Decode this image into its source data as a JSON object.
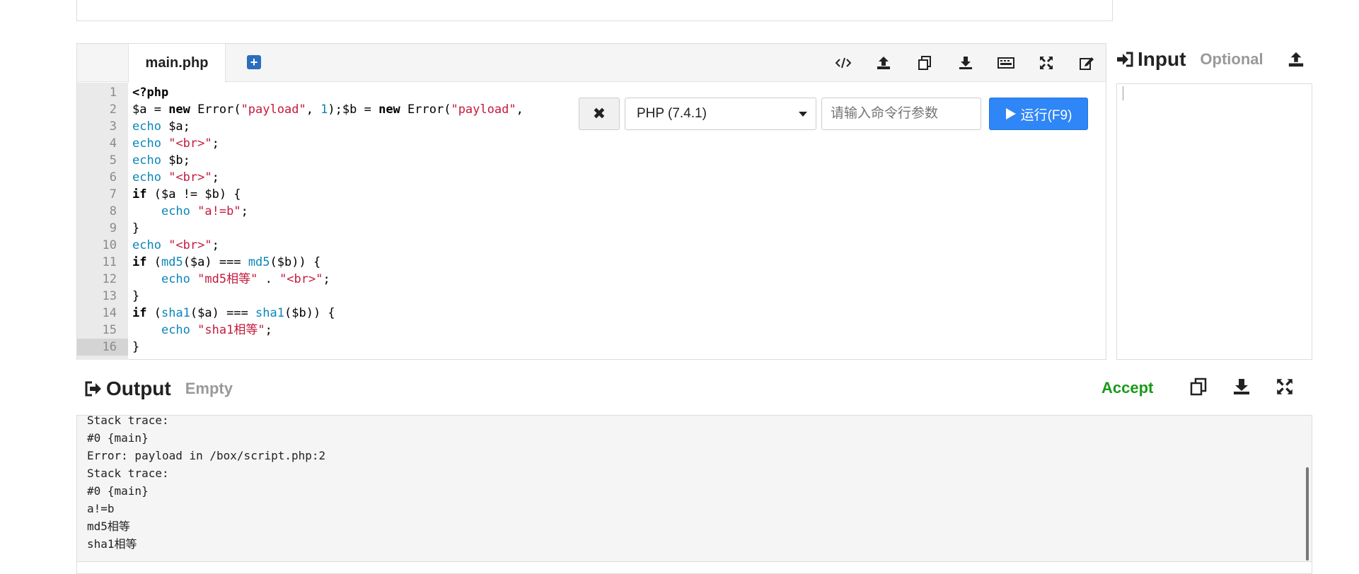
{
  "editor": {
    "tab_label": "main.php",
    "lines": [
      {
        "n": "1",
        "parts": [
          [
            "kw",
            "<?php"
          ]
        ]
      },
      {
        "n": "2",
        "parts": [
          [
            "",
            "$a = "
          ],
          [
            "kw",
            "new"
          ],
          [
            "",
            " Error("
          ],
          [
            "str",
            "\"payload\""
          ],
          [
            "",
            ", "
          ],
          [
            "num",
            "1"
          ],
          [
            "",
            ");$b = "
          ],
          [
            "kw",
            "new"
          ],
          [
            "",
            " Error("
          ],
          [
            "str",
            "\"payload\""
          ],
          [
            "",
            ","
          ]
        ]
      },
      {
        "n": "3",
        "parts": [
          [
            "fn",
            "echo"
          ],
          [
            "",
            " $a;"
          ]
        ]
      },
      {
        "n": "4",
        "parts": [
          [
            "fn",
            "echo"
          ],
          [
            "",
            " "
          ],
          [
            "str",
            "\"<br>\""
          ],
          [
            "",
            ";"
          ]
        ]
      },
      {
        "n": "5",
        "parts": [
          [
            "fn",
            "echo"
          ],
          [
            "",
            " $b;"
          ]
        ]
      },
      {
        "n": "6",
        "parts": [
          [
            "fn",
            "echo"
          ],
          [
            "",
            " "
          ],
          [
            "str",
            "\"<br>\""
          ],
          [
            "",
            ";"
          ]
        ]
      },
      {
        "n": "7",
        "parts": [
          [
            "kw",
            "if"
          ],
          [
            "",
            " ($a != $b) {"
          ]
        ]
      },
      {
        "n": "8",
        "parts": [
          [
            "",
            "    "
          ],
          [
            "fn",
            "echo"
          ],
          [
            "",
            " "
          ],
          [
            "str",
            "\"a!=b\""
          ],
          [
            "",
            ";"
          ]
        ]
      },
      {
        "n": "9",
        "parts": [
          [
            "",
            "}"
          ]
        ]
      },
      {
        "n": "10",
        "parts": [
          [
            "fn",
            "echo"
          ],
          [
            "",
            " "
          ],
          [
            "str",
            "\"<br>\""
          ],
          [
            "",
            ";"
          ]
        ]
      },
      {
        "n": "11",
        "parts": [
          [
            "kw",
            "if"
          ],
          [
            "",
            " ("
          ],
          [
            "fn",
            "md5"
          ],
          [
            "",
            "($a) === "
          ],
          [
            "fn",
            "md5"
          ],
          [
            "",
            "($b)) {"
          ]
        ]
      },
      {
        "n": "12",
        "parts": [
          [
            "",
            "    "
          ],
          [
            "fn",
            "echo"
          ],
          [
            "",
            " "
          ],
          [
            "str",
            "\"md5相等\""
          ],
          [
            "",
            " . "
          ],
          [
            "str",
            "\"<br>\""
          ],
          [
            "",
            ";"
          ]
        ]
      },
      {
        "n": "13",
        "parts": [
          [
            "",
            "}"
          ]
        ]
      },
      {
        "n": "14",
        "parts": [
          [
            "kw",
            "if"
          ],
          [
            "",
            " ("
          ],
          [
            "fn",
            "sha1"
          ],
          [
            "",
            "($a) === "
          ],
          [
            "fn",
            "sha1"
          ],
          [
            "",
            "($b)) {"
          ]
        ]
      },
      {
        "n": "15",
        "parts": [
          [
            "",
            "    "
          ],
          [
            "fn",
            "echo"
          ],
          [
            "",
            " "
          ],
          [
            "str",
            "\"sha1相等\""
          ],
          [
            "",
            ";"
          ]
        ]
      },
      {
        "n": "16",
        "parts": [
          [
            "",
            "}"
          ]
        ]
      }
    ],
    "active_line": "16"
  },
  "run_bar": {
    "language": "PHP (7.4.1)",
    "args_placeholder": "请输入命令行参数",
    "run_label": "运行(F9)"
  },
  "input_panel": {
    "title": "Input",
    "subtitle": "Optional"
  },
  "output_panel": {
    "title": "Output",
    "subtitle": "Empty",
    "status": "Accept",
    "status_color": "#1a9a1a",
    "lines": [
      "Stack trace:",
      "#0 {main}",
      "Error: payload in /box/script.php:2",
      "Stack trace:",
      "#0 {main}",
      "a!=b",
      "md5相等",
      "sha1相等"
    ]
  },
  "colors": {
    "accent": "#2f86f6",
    "keyword_function": "#0a86b8",
    "string": "#c41a3c"
  }
}
